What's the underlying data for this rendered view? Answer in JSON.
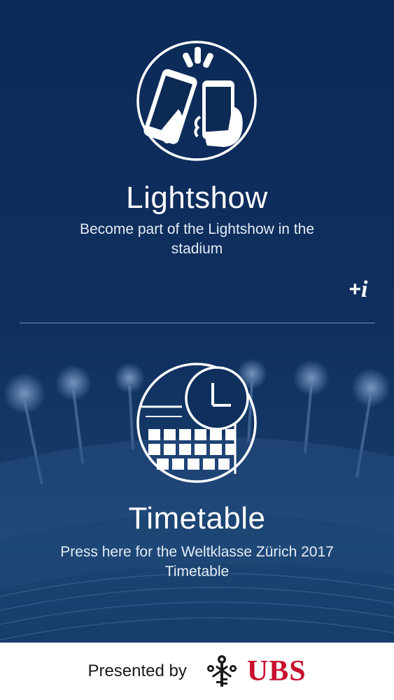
{
  "lightshow": {
    "title": "Lightshow",
    "description": "Become part of the Lightshow in the stadium",
    "icon": "phone-hands-icon",
    "info_button": {
      "plus": "+",
      "i": "i"
    }
  },
  "timetable": {
    "title": "Timetable",
    "description": "Press here for the Weltklasse Zürich 2017 Timetable",
    "icon": "calendar-clock-icon"
  },
  "footer": {
    "presented_by": "Presented by",
    "brand": "UBS",
    "brand_color": "#c8102e",
    "logo_icon": "ubs-keys-icon"
  },
  "colors": {
    "background": "#0d2a55",
    "accent_text": "#ffffff"
  }
}
